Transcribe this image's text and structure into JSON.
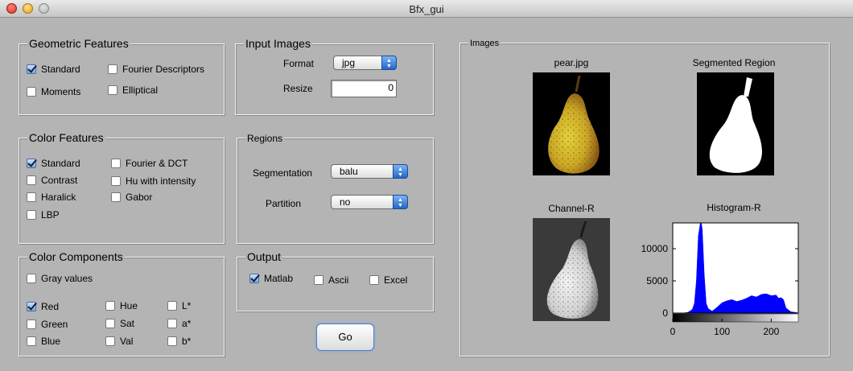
{
  "window": {
    "title": "Bfx_gui"
  },
  "geometric": {
    "title": "Geometric Features",
    "items": [
      {
        "label": "Standard",
        "checked": true
      },
      {
        "label": "Moments",
        "checked": false
      },
      {
        "label": "Fourier Descriptors",
        "checked": false
      },
      {
        "label": "Elliptical",
        "checked": false
      }
    ]
  },
  "color_features": {
    "title": "Color Features",
    "items": [
      {
        "label": "Standard",
        "checked": true
      },
      {
        "label": "Contrast",
        "checked": false
      },
      {
        "label": "Haralick",
        "checked": false
      },
      {
        "label": "LBP",
        "checked": false
      },
      {
        "label": "Fourier & DCT",
        "checked": false
      },
      {
        "label": "Hu with intensity",
        "checked": false
      },
      {
        "label": "Gabor",
        "checked": false
      }
    ]
  },
  "color_components": {
    "title": "Color Components",
    "items": [
      {
        "label": "Gray values",
        "checked": false
      },
      {
        "label": "Red",
        "checked": true
      },
      {
        "label": "Green",
        "checked": false
      },
      {
        "label": "Blue",
        "checked": false
      },
      {
        "label": "Hue",
        "checked": false
      },
      {
        "label": "Sat",
        "checked": false
      },
      {
        "label": "Val",
        "checked": false
      },
      {
        "label": "L*",
        "checked": false
      },
      {
        "label": "a*",
        "checked": false
      },
      {
        "label": "b*",
        "checked": false
      }
    ]
  },
  "input_images": {
    "title": "Input Images",
    "format_label": "Format",
    "format_value": "jpg",
    "resize_label": "Resize",
    "resize_value": "0"
  },
  "regions": {
    "title": "Regions",
    "segmentation_label": "Segmentation",
    "segmentation_value": "balu",
    "partition_label": "Partition",
    "partition_value": "no"
  },
  "output": {
    "title": "Output",
    "items": [
      {
        "label": "Matlab",
        "checked": true
      },
      {
        "label": "Ascii",
        "checked": false
      },
      {
        "label": "Excel",
        "checked": false
      }
    ]
  },
  "go_button": {
    "label": "Go"
  },
  "images": {
    "title": "Images",
    "original_caption": "pear.jpg",
    "segmented_caption": "Segmented Region",
    "channel_caption": "Channel-R",
    "histogram_caption": "Histogram-R"
  },
  "chart_data": {
    "type": "area",
    "title": "Histogram-R",
    "xlabel": "",
    "ylabel": "",
    "xlim": [
      0,
      255
    ],
    "ylim": [
      0,
      14000
    ],
    "xticks": [
      0,
      100,
      200
    ],
    "yticks": [
      0,
      5000,
      10000
    ],
    "x": [
      0,
      10,
      20,
      30,
      35,
      40,
      44,
      48,
      52,
      56,
      58,
      60,
      64,
      68,
      72,
      80,
      90,
      100,
      110,
      120,
      130,
      140,
      150,
      160,
      170,
      180,
      190,
      200,
      210,
      215,
      220,
      225,
      230,
      240,
      250,
      255
    ],
    "values": [
      0,
      0,
      0,
      100,
      300,
      600,
      1500,
      5000,
      12000,
      14000,
      14000,
      13000,
      6000,
      1500,
      700,
      300,
      900,
      1600,
      1900,
      2100,
      1800,
      2000,
      2300,
      2700,
      2500,
      2900,
      3000,
      2700,
      2800,
      2300,
      2400,
      2100,
      800,
      200,
      100,
      0
    ],
    "fill_color": "#0000ff",
    "colorbar": "grayscale",
    "grid": false
  }
}
